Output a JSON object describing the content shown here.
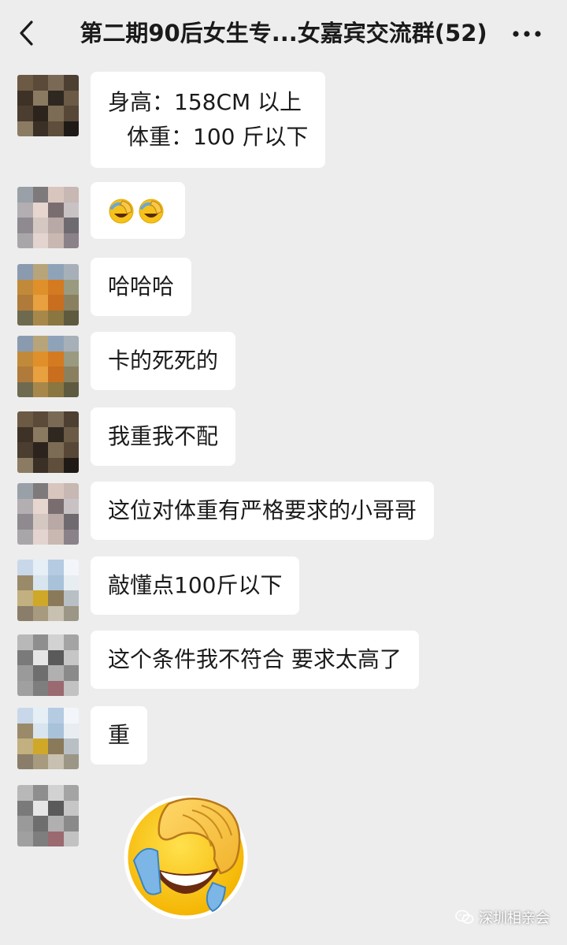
{
  "header": {
    "title": "第二期90后女生专...女嘉宾交流群(52)",
    "back_icon": "chevron-left-icon",
    "more_icon": "more-dots-icon"
  },
  "messages": [
    {
      "id": 1,
      "type": "text",
      "avatar": "avatar-brown",
      "lines": [
        "身高：158CM 以上",
        "体重：100 斤以下"
      ]
    },
    {
      "id": 2,
      "type": "emoji-inline",
      "avatar": "avatar-girl",
      "emoji": [
        "facepalm-laugh-emoji",
        "facepalm-laugh-emoji"
      ]
    },
    {
      "id": 3,
      "type": "text",
      "avatar": "avatar-flower",
      "text": "哈哈哈"
    },
    {
      "id": 4,
      "type": "text",
      "avatar": "avatar-flower",
      "text": "卡的死死的"
    },
    {
      "id": 5,
      "type": "text",
      "avatar": "avatar-brown",
      "text": "我重我不配"
    },
    {
      "id": 6,
      "type": "text",
      "avatar": "avatar-girl",
      "text": "这位对体重有严格要求的小哥哥"
    },
    {
      "id": 7,
      "type": "text",
      "avatar": "avatar-sky",
      "text": "敲懂点100斤以下"
    },
    {
      "id": 8,
      "type": "text",
      "avatar": "avatar-grey",
      "text": "这个条件我不符合 要求太高了"
    },
    {
      "id": 9,
      "type": "text",
      "avatar": "avatar-sky",
      "text": "重"
    },
    {
      "id": 10,
      "type": "sticker",
      "avatar": "avatar-grey",
      "sticker": "facepalm-laugh-emoji"
    }
  ],
  "watermark": {
    "text": "深圳相亲会",
    "icon": "wechat-icon"
  },
  "colors": {
    "background": "#ededed",
    "bubble": "#ffffff",
    "text": "#191919"
  }
}
